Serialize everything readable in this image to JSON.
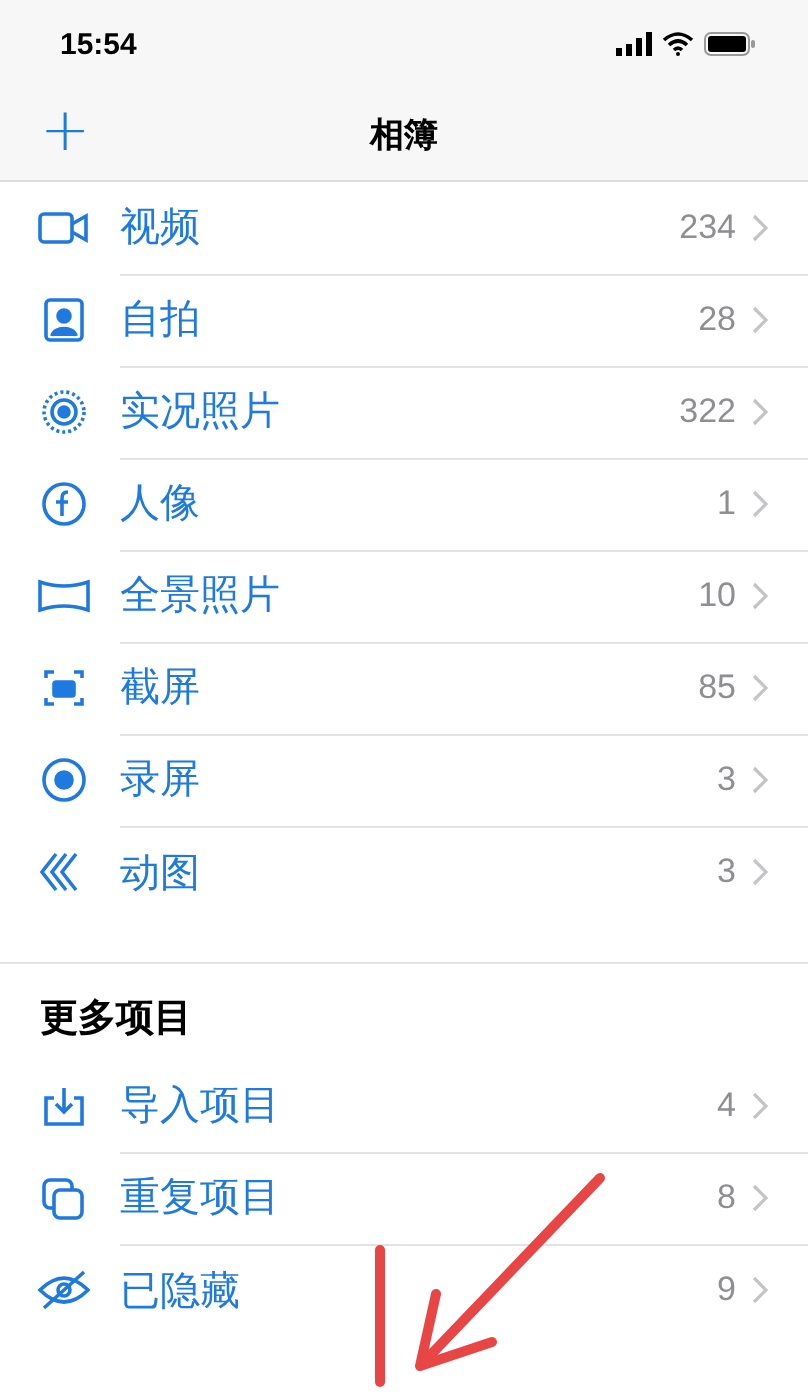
{
  "status_bar": {
    "time": "15:54"
  },
  "nav": {
    "add": "+",
    "title": "相簿"
  },
  "media_types": [
    {
      "kind": "video",
      "label": "视频",
      "count": "234"
    },
    {
      "kind": "selfie",
      "label": "自拍",
      "count": "28"
    },
    {
      "kind": "live",
      "label": "实况照片",
      "count": "322"
    },
    {
      "kind": "portrait",
      "label": "人像",
      "count": "1"
    },
    {
      "kind": "panorama",
      "label": "全景照片",
      "count": "10"
    },
    {
      "kind": "screenshot",
      "label": "截屏",
      "count": "85"
    },
    {
      "kind": "recording",
      "label": "录屏",
      "count": "3"
    },
    {
      "kind": "animated",
      "label": "动图",
      "count": "3"
    }
  ],
  "more": {
    "title": "更多项目",
    "items": [
      {
        "kind": "import",
        "label": "导入项目",
        "count": "4"
      },
      {
        "kind": "duplicate",
        "label": "重复项目",
        "count": "8"
      },
      {
        "kind": "hidden",
        "label": "已隐藏",
        "count": "9"
      }
    ]
  }
}
